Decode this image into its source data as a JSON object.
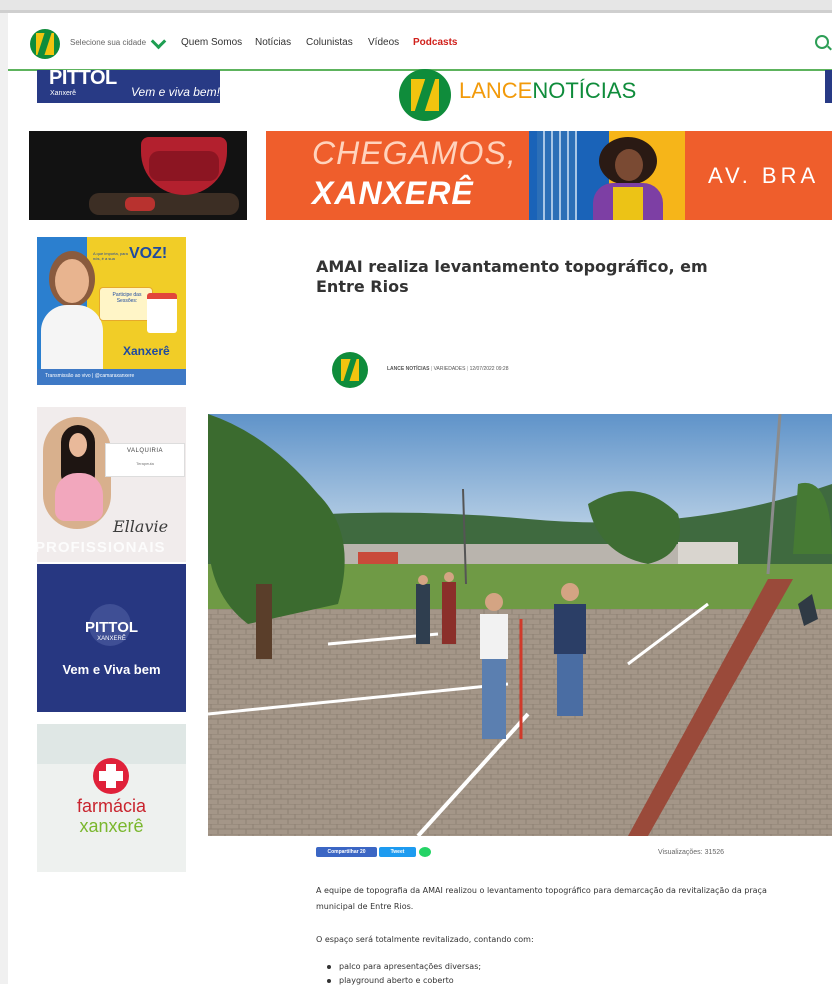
{
  "nav": {
    "city_selector": "Selecione sua cidade",
    "items": [
      "Quem Somos",
      "Notícias",
      "Colunistas",
      "Vídeos"
    ],
    "highlight": "Podcasts"
  },
  "brand": {
    "part1": "LANCE",
    "part2": "NOTÍCIAS"
  },
  "ads": {
    "pittol_top": {
      "brand": "PITTOL",
      "city": "Xanxerê",
      "slogan": "Vem e viva bem!"
    },
    "chegamos": {
      "line1": "CHEGAMOS,",
      "line2": "XANXERÊ",
      "street": "AV. BRA"
    },
    "voz": {
      "headline": "VOZ!",
      "small": "A que importa, para nós, é a sua",
      "card": "Participe das Sessões:",
      "logo": "Xanxerê",
      "footer": "Transmissão ao vivo | @camaraxanxere"
    },
    "valquiria": {
      "name": "VALQUIRIA",
      "subtitle": "Terapeuta",
      "brand": "Ellavie",
      "watermark": "PROFISSIONAIS"
    },
    "pittol_side": {
      "brand": "PITTOL",
      "city": "XANXERÊ",
      "slogan": "Vem e Viva bem"
    },
    "farmacia": {
      "name": "farmácia",
      "city": "xanxerê"
    }
  },
  "article": {
    "title": "AMAI realiza levantamento topográfico, em Entre Rios",
    "author": "LANCE NOTÍCIAS",
    "category": "VARIEDADES",
    "datetime": "12/07/2022 09:28",
    "share_facebook": "Compartilhar 20",
    "share_twitter": "Tweet",
    "views": "Visualizações: 31526",
    "paragraph1": "A equipe de topografia da AMAI realizou o levantamento topográfico para demarcação da revitalização da praça municipal de Entre Rios.",
    "paragraph2": "O espaço será totalmente revitalizado, contando com:",
    "bullets": [
      "palco para apresentações diversas;",
      "playground aberto e coberto"
    ]
  },
  "colors": {
    "brand_green": "#0f8c3b",
    "brand_orange": "#f29a0a",
    "nav_highlight": "#d0201b"
  }
}
